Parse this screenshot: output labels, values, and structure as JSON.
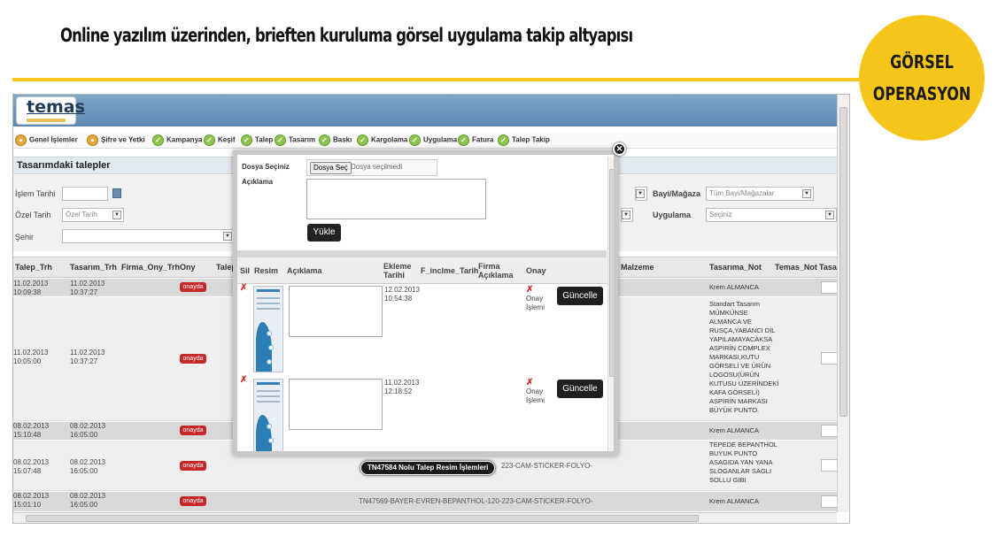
{
  "slide": {
    "title": "Online yazılım üzerinden, brieften kuruluma görsel uygulama takip altyapısı",
    "badge_line1": "GÖRSEL",
    "badge_line2": "OPERASYON",
    "accent_color": "#f5c51a"
  },
  "app": {
    "logo_text": "temas",
    "menu": [
      {
        "label": "Genel İşlemler",
        "icon": "user-icon"
      },
      {
        "label": "Şifre ve Yetki",
        "icon": "key-icon"
      },
      {
        "label": "Kampanya",
        "icon": "check-icon"
      },
      {
        "label": "Keşif",
        "icon": "check-icon"
      },
      {
        "label": "Talep",
        "icon": "check-icon"
      },
      {
        "label": "Tasarım",
        "icon": "check-icon"
      },
      {
        "label": "Baskı",
        "icon": "check-icon"
      },
      {
        "label": "Kargolama",
        "icon": "check-icon"
      },
      {
        "label": "Uygulama",
        "icon": "check-icon"
      },
      {
        "label": "Fatura",
        "icon": "check-icon"
      },
      {
        "label": "Talep Takip",
        "icon": "check-icon"
      }
    ],
    "section_title": "Tasarımdaki talepler",
    "filters": {
      "islem_tarihi": "İşlem Tarihi",
      "ozel_tarih": "Özel Tarih",
      "ozel_tarih_value": "Özel Tarih",
      "sehir": "Şehir",
      "bayi_magaza": "Bayi/Mağaza",
      "bayi_magaza_value": "Tüm Bayi/Mağazalar",
      "uygulama": "Uygulama",
      "uygulama_value": "Seçiniz"
    },
    "grid": {
      "headers": [
        "Talep_Trh",
        "Tasarım_Trh",
        "Firma_Ony_Trh",
        "Ony",
        "Talep",
        "Malzeme",
        "Tasarıma_Not",
        "Temas_Not",
        "Tasarı"
      ],
      "rows": [
        {
          "talep": "11.02.2013 10:09:38",
          "tasarim": "11.02.2013 10:37:27",
          "status": "onayda",
          "note": "Krem ALMANCA",
          "text": ""
        },
        {
          "talep": "11.02.2013 10:05:00",
          "tasarim": "11.02.2013 10:37:27",
          "status": "onayda",
          "note": "Standart Tasarım MÜMKÜNSE ALMANCA VE RUSÇA,YABANCI DİL YAPILAMAYACAKSA ASPİRİN COMPLEX MARKASI,KUTU GÖRSELİ VE ÜRÜN LOGOSU(ÜRÜN KUTUSU ÜZERİNDEKİ KAFA GÖRSELİ) ASPİRİN MARKASI BÜYÜK PUNTO.",
          "text": ""
        },
        {
          "talep": "08.02.2013 15:10:48",
          "tasarim": "08.02.2013 16:05:00",
          "status": "onayda",
          "note": "Krem ALMANCA",
          "text": ""
        },
        {
          "talep": "08.02.2013 15:07:48",
          "tasarim": "08.02.2013 16:05:00",
          "status": "onayda",
          "note": "TEPEDE BEPANTHOL BUYUK PUNTO ASAGIDA YAN YANA SLOGANLAR SAGLI SOLLU GIBI",
          "text": "223-CAM-STICKER-FOLYO-"
        },
        {
          "talep": "08.02.2013 15:01:10",
          "tasarim": "08.02.2013 16:05:00",
          "status": "onayda",
          "note": "Krem ALMANCA",
          "text": "TN47569-BAYER-EVREN-BEPANTHOL-120-223-CAM-STICKER-FOLYO-"
        }
      ]
    }
  },
  "modal": {
    "dosya_label": "Dosya Seçiniz",
    "file_button": "Dosya Seç",
    "file_status": "Dosya seçilmedi",
    "aciklama_label": "Açıklama",
    "upload_button": "Yükle",
    "headers": {
      "sil": "Sil",
      "resim": "Resim",
      "aciklama": "Açıklama",
      "ekleme": "Ekleme Tarihi",
      "f_inclme": "F_inclme_Tarih",
      "firma": "Firma Açıklama",
      "onay": "Onay"
    },
    "rows": [
      {
        "sil": "✗",
        "date": "12.02.2013 10:54:38",
        "onay_mark": "✗",
        "onay_text": "Onay İşlemi",
        "button": "Güncelle"
      },
      {
        "sil": "✗",
        "date": "11.02.2013 12:18:52",
        "onay_mark": "✗",
        "onay_text": "Onay İşlemi",
        "button": "Güncelle"
      }
    ],
    "caption": "TN47584 Nolu Talep Resim İşlemleri"
  }
}
